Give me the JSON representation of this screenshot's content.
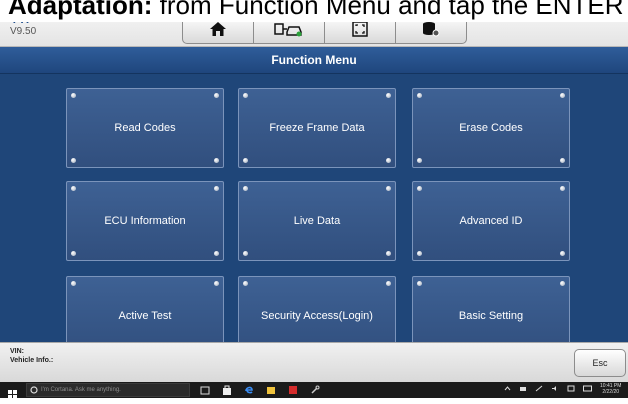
{
  "caption": {
    "bold": "Adaptation:",
    "rest": " from Function Menu and tap the ENTER"
  },
  "app": {
    "brand": "VW",
    "version": "V9.50"
  },
  "toolbar": {
    "buttons": [
      "home-icon",
      "vehicle-icon",
      "screenshot-icon",
      "data-manager-icon"
    ]
  },
  "menu": {
    "title": "Function Menu"
  },
  "tiles": [
    {
      "label": "Read Codes"
    },
    {
      "label": "Freeze Frame Data"
    },
    {
      "label": "Erase Codes"
    },
    {
      "label": "ECU Information"
    },
    {
      "label": "Live Data"
    },
    {
      "label": "Advanced ID"
    },
    {
      "label": "Active Test"
    },
    {
      "label": "Security Access(Login)"
    },
    {
      "label": "Basic Setting"
    }
  ],
  "footer": {
    "vin_label": "VIN:",
    "vehicle_info_label": "Vehicle Info.:",
    "esc": "Esc"
  },
  "taskbar": {
    "search_placeholder": "I'm Cortana. Ask me anything.",
    "time": "10:41 PM",
    "date": "2/22/20"
  },
  "colors": {
    "accent": "#1f4679",
    "tile": "#3a5b8c",
    "header": "#f0f0f0"
  }
}
